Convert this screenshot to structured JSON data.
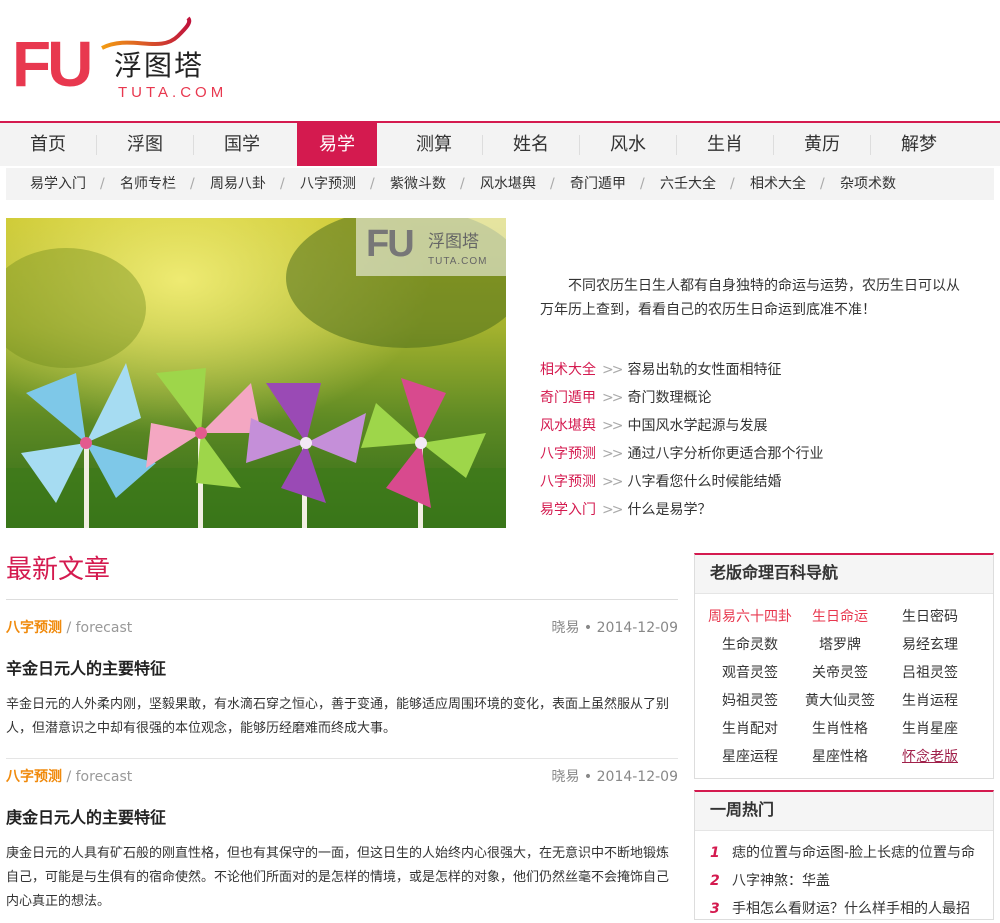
{
  "logo": {
    "mark": "FU",
    "cn": "浮图塔",
    "en": "TUTA.COM"
  },
  "main_nav": [
    "首页",
    "浮图",
    "国学",
    "易学",
    "测算",
    "姓名",
    "风水",
    "生肖",
    "黄历",
    "解梦"
  ],
  "main_nav_active": "易学",
  "sub_nav": [
    "易学入门",
    "名师专栏",
    "周易八卦",
    "八字预测",
    "紫微斗数",
    "风水堪舆",
    "奇门遁甲",
    "六壬大全",
    "相术大全",
    "杂项术数"
  ],
  "hero": {
    "watermark_mark": "FU",
    "watermark_cn": "浮图塔",
    "watermark_en": "TUTA.COM",
    "intro": "不同农历生日生人都有自身独特的命运与运势，农历生日可以从万年历上查到，看看自己的农历生日命运到底准不准！",
    "arrow": ">>",
    "links": [
      {
        "cat": "相术大全",
        "title": "容易出轨的女性面相特征"
      },
      {
        "cat": "奇门遁甲",
        "title": "奇门数理概论"
      },
      {
        "cat": "风水堪舆",
        "title": "中国风水学起源与发展"
      },
      {
        "cat": "八字预测",
        "title": "通过八字分析你更适合那个行业"
      },
      {
        "cat": "八字预测",
        "title": "八字看您什么时候能结婚"
      },
      {
        "cat": "易学入门",
        "title": "什么是易学？"
      }
    ]
  },
  "latest": {
    "heading": "最新文章",
    "articles": [
      {
        "cat": "八字预测",
        "en": "/ forecast",
        "author": "晓易",
        "date": "2014-12-09",
        "title": "辛金日元人的主要特征",
        "summary": "辛金日元的人外柔内刚，坚毅果敢，有水滴石穿之恒心，善于变通，能够适应周围环境的变化，表面上虽然服从了别人，但潜意识之中却有很强的本位观念，能够历经磨难而终成大事。"
      },
      {
        "cat": "八字预测",
        "en": "/ forecast",
        "author": "晓易",
        "date": "2014-12-09",
        "title": "庚金日元人的主要特征",
        "summary": "庚金日元的人具有矿石般的刚直性格，但也有其保守的一面，但这日生的人始终内心很强大，在无意识中不断地锻炼自己，可能是与生俱有的宿命使然。不论他们所面对的是怎样的情境，或是怎样的对象，他们仍然丝毫不会掩饰自己内心真正的想法。"
      }
    ]
  },
  "sidebar": {
    "nav_title": "老版命理百科导航",
    "nav_items": [
      "周易六十四卦",
      "生日命运",
      "生日密码",
      "生命灵数",
      "塔罗牌",
      "易经玄理",
      "观音灵签",
      "关帝灵签",
      "吕祖灵签",
      "妈祖灵签",
      "黄大仙灵签",
      "生肖运程",
      "生肖配对",
      "生肖性格",
      "生肖星座",
      "星座运程",
      "星座性格",
      "怀念老版"
    ],
    "hot_title": "一周热门",
    "hot_items": [
      {
        "num": "1",
        "title": "痣的位置与命运图-脸上长痣的位置与命"
      },
      {
        "num": "2",
        "title": "八字神煞：华盖"
      },
      {
        "num": "3",
        "title": "手相怎么看财运？什么样手相的人最招"
      }
    ]
  }
}
